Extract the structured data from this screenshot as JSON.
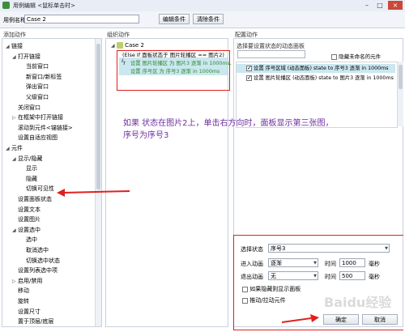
{
  "window": {
    "title": "用例编辑 <鼠标单击时>"
  },
  "toolbar": {
    "case_name_label": "用例名称:",
    "case_name_value": "Case 2",
    "edit_condition": "编辑条件",
    "clear_condition": "清除条件"
  },
  "left": {
    "header": "添加动作",
    "items": [
      {
        "label": "链接",
        "level": 0,
        "expand": "open"
      },
      {
        "label": "打开链接",
        "level": 1,
        "expand": "open"
      },
      {
        "label": "当前窗口",
        "level": 2
      },
      {
        "label": "新窗口/新标签",
        "level": 2
      },
      {
        "label": "弹出窗口",
        "level": 2
      },
      {
        "label": "父级窗口",
        "level": 2
      },
      {
        "label": "关闭窗口",
        "level": 1
      },
      {
        "label": "在框架中打开链接",
        "level": 1,
        "expand": "closed"
      },
      {
        "label": "滚动到元件<锚链接>",
        "level": 1
      },
      {
        "label": "设置自适应视图",
        "level": 1
      },
      {
        "label": "元件",
        "level": 0,
        "expand": "open"
      },
      {
        "label": "显示/隐藏",
        "level": 1,
        "expand": "open"
      },
      {
        "label": "显示",
        "level": 2
      },
      {
        "label": "隐藏",
        "level": 2
      },
      {
        "label": "切换可见性",
        "level": 2
      },
      {
        "label": "设置面板状态",
        "level": 1
      },
      {
        "label": "设置文本",
        "level": 1
      },
      {
        "label": "设置图片",
        "level": 1
      },
      {
        "label": "设置选中",
        "level": 1,
        "expand": "open"
      },
      {
        "label": "选中",
        "level": 2
      },
      {
        "label": "取消选中",
        "level": 2
      },
      {
        "label": "切换选中状态",
        "level": 2
      },
      {
        "label": "设置列表选中项",
        "level": 1
      },
      {
        "label": "启用/禁用",
        "level": 1,
        "expand": "closed"
      },
      {
        "label": "移动",
        "level": 1
      },
      {
        "label": "旋转",
        "level": 1
      },
      {
        "label": "设置尺寸",
        "level": 1
      },
      {
        "label": "置于顶层/底层",
        "level": 1
      }
    ]
  },
  "middle": {
    "header": "组织动作",
    "case_title": "Case 2",
    "condition": "(Else If 面板状态于 图片轮播区 == 图片2)",
    "action_l1": "设置 图片轮播区 为 图片3 逐渐 in 1000ms,",
    "action_l2": "设置 序号区 为 序号3 逐渐 in 1000ms"
  },
  "right": {
    "header": "配置动作",
    "sub_header": "选择要设置状态的动态面板",
    "hide_unnamed": "隐藏未命名的元件",
    "rows": [
      "设置 序号区域 (动态面板) state to 序号3 逐渐 in 1000ms",
      "设置 图片轮播区 (动态面板) state to 图片3 逐渐 in 1000ms"
    ],
    "select_state_label": "选择状态",
    "select_state_value": "序号3",
    "enter_anim_label": "进入动画",
    "enter_anim_value": "逐渐",
    "enter_time_label": "时间",
    "enter_time_value": "1000",
    "enter_unit": "毫秒",
    "exit_anim_label": "退出动画",
    "exit_anim_value": "无",
    "exit_time_label": "时间",
    "exit_time_value": "500",
    "exit_unit": "毫秒",
    "opt1": "如果隐藏则显示面板",
    "opt2": "推动/拉动元件",
    "ok": "确定",
    "cancel": "取消"
  },
  "annotation": {
    "line1": "如果  状态在图片2上，单击右方向时，面板显示第三张图，",
    "line2": "序号为序号3"
  },
  "watermark": "Baidu经验"
}
